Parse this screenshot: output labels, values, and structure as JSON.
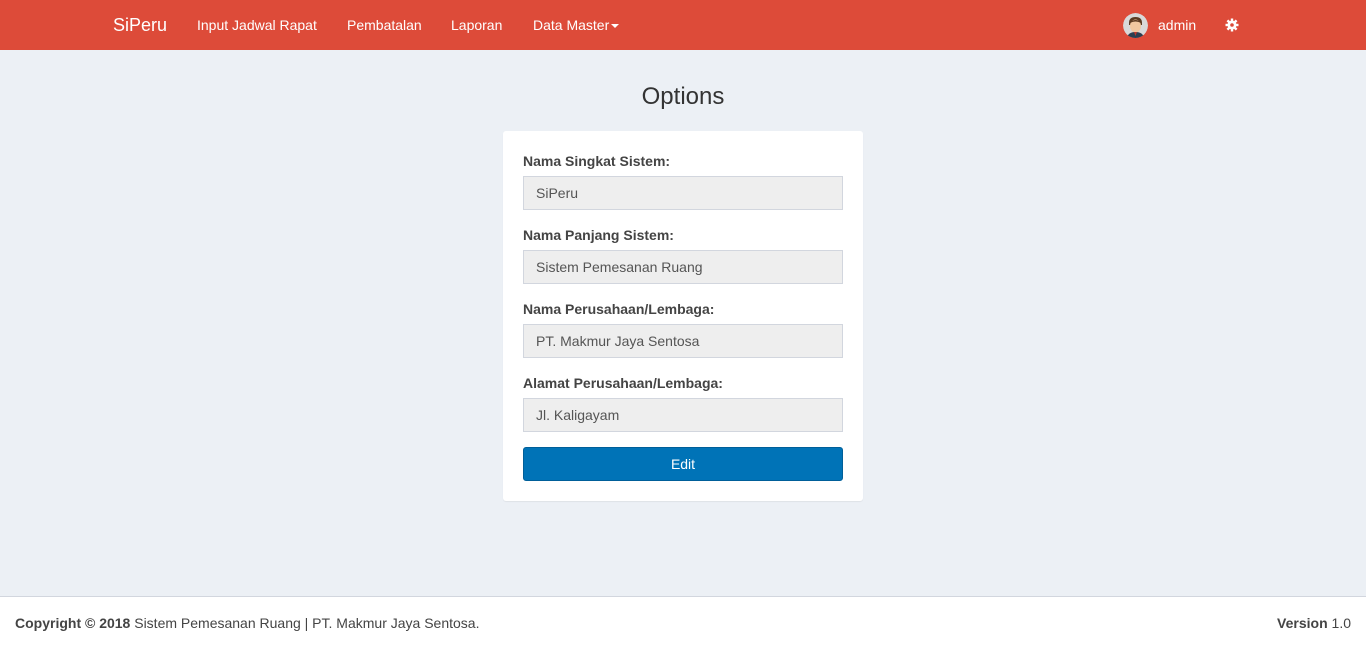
{
  "navbar": {
    "brand": "SiPeru",
    "items": [
      {
        "label": "Input Jadwal Rapat"
      },
      {
        "label": "Pembatalan"
      },
      {
        "label": "Laporan"
      },
      {
        "label": "Data Master"
      }
    ],
    "user_name": "admin",
    "background_color": "#dd4b39"
  },
  "page": {
    "title": "Options"
  },
  "form": {
    "fields": [
      {
        "label": "Nama Singkat Sistem:",
        "value": "SiPeru"
      },
      {
        "label": "Nama Panjang Sistem:",
        "value": "Sistem Pemesanan Ruang"
      },
      {
        "label": "Nama Perusahaan/Lembaga:",
        "value": "PT. Makmur Jaya Sentosa"
      },
      {
        "label": "Alamat Perusahaan/Lembaga:",
        "value": "Jl. Kaligayam"
      }
    ],
    "edit_label": "Edit",
    "button_color": "#0073b7"
  },
  "footer": {
    "copyright_label": "Copyright © 2018",
    "copyright_text": " Sistem Pemesanan Ruang | PT. Makmur Jaya Sentosa.",
    "version_label": "Version",
    "version_value": " 1.0"
  }
}
